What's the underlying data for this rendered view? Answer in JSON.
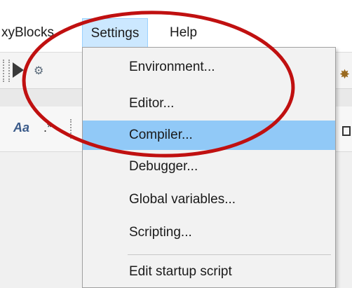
{
  "menubar": {
    "items": [
      {
        "label": "xyBlocks"
      },
      {
        "label": "Settings"
      },
      {
        "label": "Help"
      }
    ]
  },
  "toolbar": {
    "icons": [
      "play-icon",
      "build-icon",
      "settings-icon"
    ]
  },
  "format_toolbar": {
    "match_case_label": "Aa",
    "regex_label": ".*"
  },
  "settings_menu": {
    "items": [
      {
        "label": "Environment..."
      },
      {
        "label": "Editor..."
      },
      {
        "label": "Compiler..."
      },
      {
        "label": "Debugger..."
      },
      {
        "label": "Global variables..."
      },
      {
        "label": "Scripting..."
      },
      {
        "label": "Edit startup script"
      }
    ],
    "highlighted_index": 2
  },
  "colors": {
    "highlight": "#91c9f7",
    "menu_active": "#cce8ff",
    "annotation": "#c01010"
  }
}
